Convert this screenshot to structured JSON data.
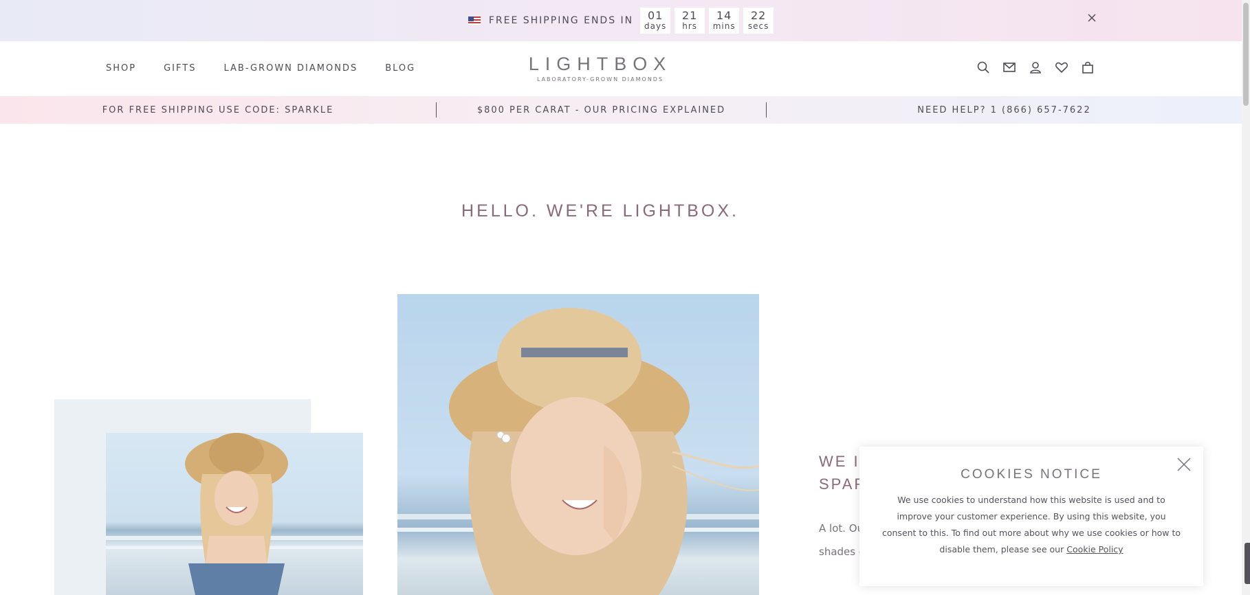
{
  "promo_bar": {
    "text": "FREE SHIPPING ENDS IN",
    "countdown": [
      {
        "value": "01",
        "unit": "days"
      },
      {
        "value": "21",
        "unit": "hrs"
      },
      {
        "value": "14",
        "unit": "mins"
      },
      {
        "value": "22",
        "unit": "secs"
      }
    ],
    "close_icon": "close-icon"
  },
  "header": {
    "nav": [
      "SHOP",
      "GIFTS",
      "LAB-GROWN DIAMONDS",
      "BLOG"
    ],
    "logo": {
      "main": "LIGHTBOX",
      "sub": "LABORATORY-GROWN DIAMONDS"
    },
    "icons": [
      "search-icon",
      "mail-icon",
      "account-icon",
      "heart-icon",
      "bag-icon"
    ]
  },
  "info_strip": {
    "items": [
      "FOR FREE SHIPPING USE CODE: SPARKLE",
      "$800 PER CARAT - OUR PRICING EXPLAINED",
      "NEED HELP? 1 (866) 657-7622"
    ]
  },
  "hero": {
    "heading": "HELLO. WE'RE LIGHTBOX.",
    "right_title_line1": "WE I",
    "right_title_line2": "SPAR",
    "right_text_line1": "A lot. Ou",
    "right_text_line2": "shades o"
  },
  "cookie": {
    "title": "COOKIES NOTICE",
    "body": "We use cookies to understand how this website is used and to improve your customer experience. By using this website, you consent to this. To find out more about why we use cookies or how to disable them, please see our",
    "link": "Cookie Policy"
  },
  "colors": {
    "text": "#4e4b55",
    "accent_mauve": "#8a6a7a",
    "logo_gray": "#77737a"
  }
}
